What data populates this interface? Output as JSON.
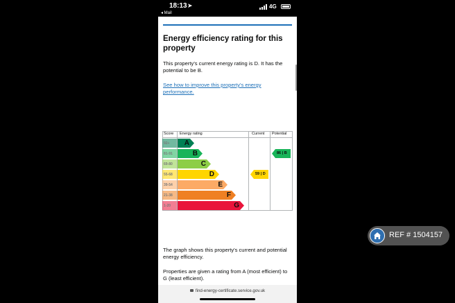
{
  "status_bar": {
    "time": "18:13",
    "location_glyph": "➤",
    "back_label": "◂ Mail",
    "network": "4G",
    "icons": [
      "location-arrow-icon",
      "signal-icon",
      "battery-icon"
    ]
  },
  "page": {
    "heading": "Energy efficiency rating for this property",
    "paragraph_1": "This property's current energy rating is D. It has the potential to be B.",
    "improve_link": "See how to improve this property's energy performance.",
    "paragraph_2": "The graph shows this property's current and potential energy efficiency.",
    "paragraph_3": "Properties are given a rating from A (most efficient) to G (least efficient)."
  },
  "chart_data": {
    "type": "table",
    "headers": {
      "score": "Score",
      "rating": "Energy rating",
      "current": "Current",
      "potential": "Potential"
    },
    "bands": [
      {
        "letter": "A",
        "range": "92+",
        "color": "#008054"
      },
      {
        "letter": "B",
        "range": "81-91",
        "color": "#19b459"
      },
      {
        "letter": "C",
        "range": "69-80",
        "color": "#8dce46"
      },
      {
        "letter": "D",
        "range": "55-68",
        "color": "#ffd500"
      },
      {
        "letter": "E",
        "range": "39-54",
        "color": "#fcaa65"
      },
      {
        "letter": "F",
        "range": "21-38",
        "color": "#ef8023"
      },
      {
        "letter": "G",
        "range": "1-20",
        "color": "#e9153b"
      }
    ],
    "current": {
      "score": 59,
      "band": "D",
      "label": "59 | D",
      "color": "#ffd500"
    },
    "potential": {
      "score": 86,
      "band": "B",
      "label": "86 | B",
      "color": "#19b459"
    }
  },
  "browser": {
    "url": "find-energy-certificate.service.gov.uk"
  },
  "watermark": {
    "text": "REF # 1504157",
    "icon": "home-icon"
  }
}
